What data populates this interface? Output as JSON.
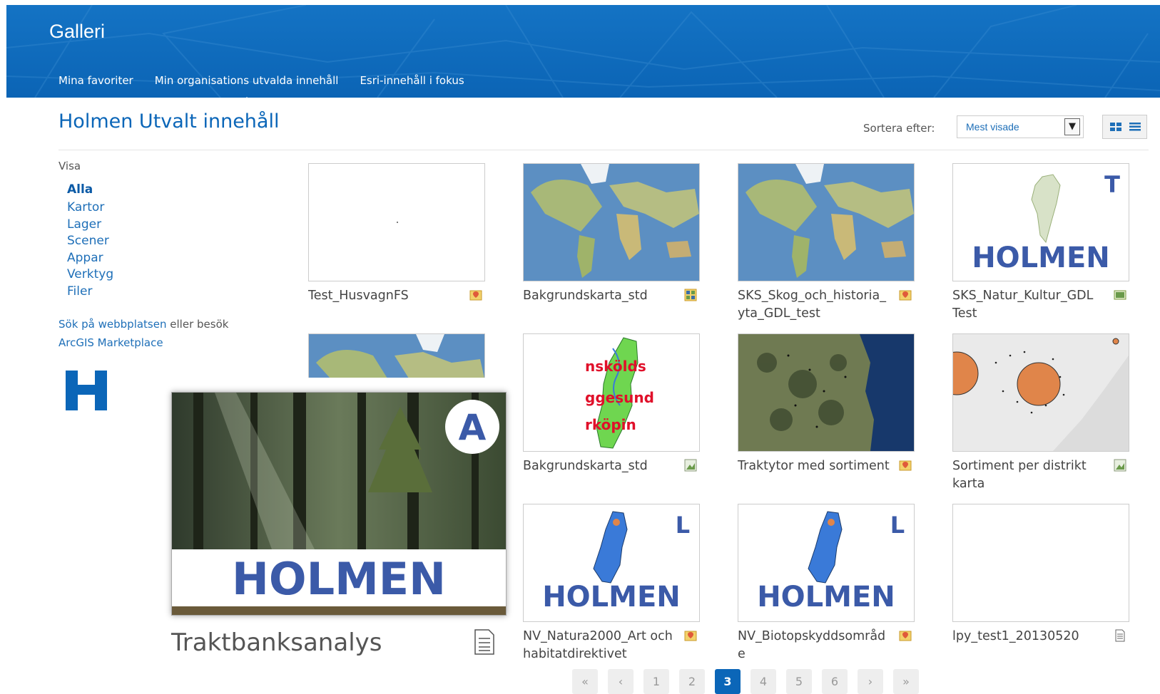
{
  "header": {
    "title": "Galleri",
    "tabs": [
      {
        "label": "Mina favoriter"
      },
      {
        "label": "Min organisations utvalda innehåll"
      },
      {
        "label": "Esri-innehåll i fokus"
      }
    ]
  },
  "page": {
    "title": "Holmen Utvalt innehåll",
    "sort_label": "Sortera efter:",
    "sort_value": "Mest visade",
    "view_grid_icon": "grid-view-icon",
    "view_list_icon": "list-view-icon"
  },
  "sidebar": {
    "visa_label": "Visa",
    "filters": [
      {
        "label": "Alla",
        "active": true
      },
      {
        "label": "Kartor"
      },
      {
        "label": "Lager"
      },
      {
        "label": "Scener"
      },
      {
        "label": "Appar"
      },
      {
        "label": "Verktyg"
      },
      {
        "label": "Filer"
      }
    ],
    "search_link": "Sök på webbplatsen",
    "search_mid": "eller besök",
    "marketplace_link": "ArcGIS Marketplace",
    "logo_letter": "H"
  },
  "cards": [
    {
      "title": "Test_HusvagnFS",
      "icon": "map-pin-icon"
    },
    {
      "title": "Bakgrundskarta_std",
      "icon": "map-tile-layer-icon"
    },
    {
      "title": "SKS_Skog_och_historia_yta_GDL_test",
      "icon": "map-pin-icon"
    },
    {
      "title": "SKS_Natur_Kultur_GDL Test",
      "icon": "app-icon",
      "badge": "T",
      "brand": "HOLMEN"
    },
    {
      "title": "Bakgrundskarta_std",
      "icon": "map-image-icon",
      "labels": [
        "nskölds",
        "ggesund",
        "rköpin"
      ]
    },
    {
      "title": "Traktytor med sortiment",
      "icon": "map-pin-icon"
    },
    {
      "title": "Sortiment per distrikt karta",
      "icon": "map-image-icon"
    },
    {
      "title": "NV_Natura2000_Art och habitatdirektivet",
      "icon": "map-pin-icon",
      "badge": "L",
      "brand": "HOLMEN"
    },
    {
      "title": "NV_Biotopskyddsområde",
      "icon": "map-pin-icon",
      "badge": "L",
      "brand": "HOLMEN"
    },
    {
      "title": "lpy_test1_20130520",
      "icon": "document-icon"
    }
  ],
  "big_card": {
    "title": "Traktbanksanalys",
    "badge": "A",
    "brand": "HOLMEN",
    "icon": "document-icon"
  },
  "pagination": {
    "pages": [
      "«",
      "‹",
      "1",
      "2",
      "3",
      "4",
      "5",
      "6",
      "›",
      "»"
    ],
    "current": "3"
  },
  "colors": {
    "header": "#0b64b5",
    "link": "#1e6fb8",
    "brand_blue": "#3b5aa8",
    "active_page": "#0b66b8"
  }
}
